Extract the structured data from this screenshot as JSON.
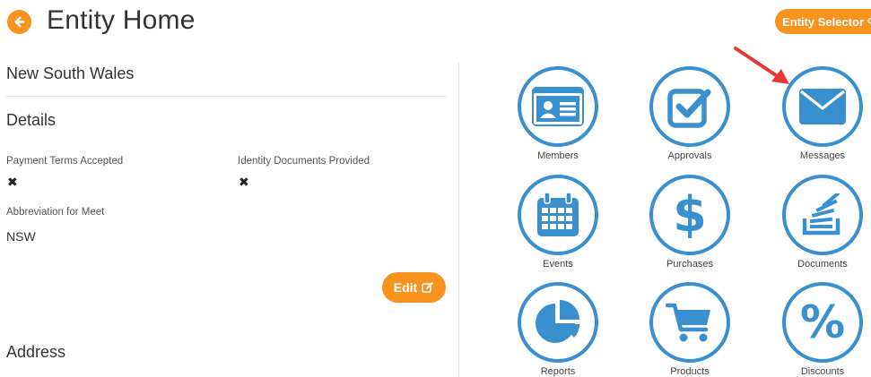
{
  "header": {
    "title": "Entity Home",
    "entity_selector_label": "Entity Selector"
  },
  "entity": {
    "name": "New South Wales"
  },
  "details": {
    "heading": "Details",
    "fields": [
      {
        "label": "Payment Terms Accepted",
        "value": "✖"
      },
      {
        "label": "Identity Documents Provided",
        "value": "✖"
      },
      {
        "label": "Abbreviation for Meet",
        "value": "NSW"
      }
    ],
    "edit_label": "Edit"
  },
  "address": {
    "heading": "Address"
  },
  "tiles": [
    {
      "label": "Members",
      "icon": "id-card-icon"
    },
    {
      "label": "Approvals",
      "icon": "check-square-icon"
    },
    {
      "label": "Messages",
      "icon": "envelope-icon"
    },
    {
      "label": "Events",
      "icon": "calendar-icon"
    },
    {
      "label": "Purchases",
      "icon": "dollar-icon"
    },
    {
      "label": "Documents",
      "icon": "stack-documents-icon"
    },
    {
      "label": "Reports",
      "icon": "pie-chart-icon"
    },
    {
      "label": "Products",
      "icon": "shopping-cart-icon"
    },
    {
      "label": "Discounts",
      "icon": "percent-icon"
    }
  ],
  "colors": {
    "accent_orange": "#f7931e",
    "tile_blue": "#3a8fcf",
    "arrow_red": "#e53935"
  }
}
